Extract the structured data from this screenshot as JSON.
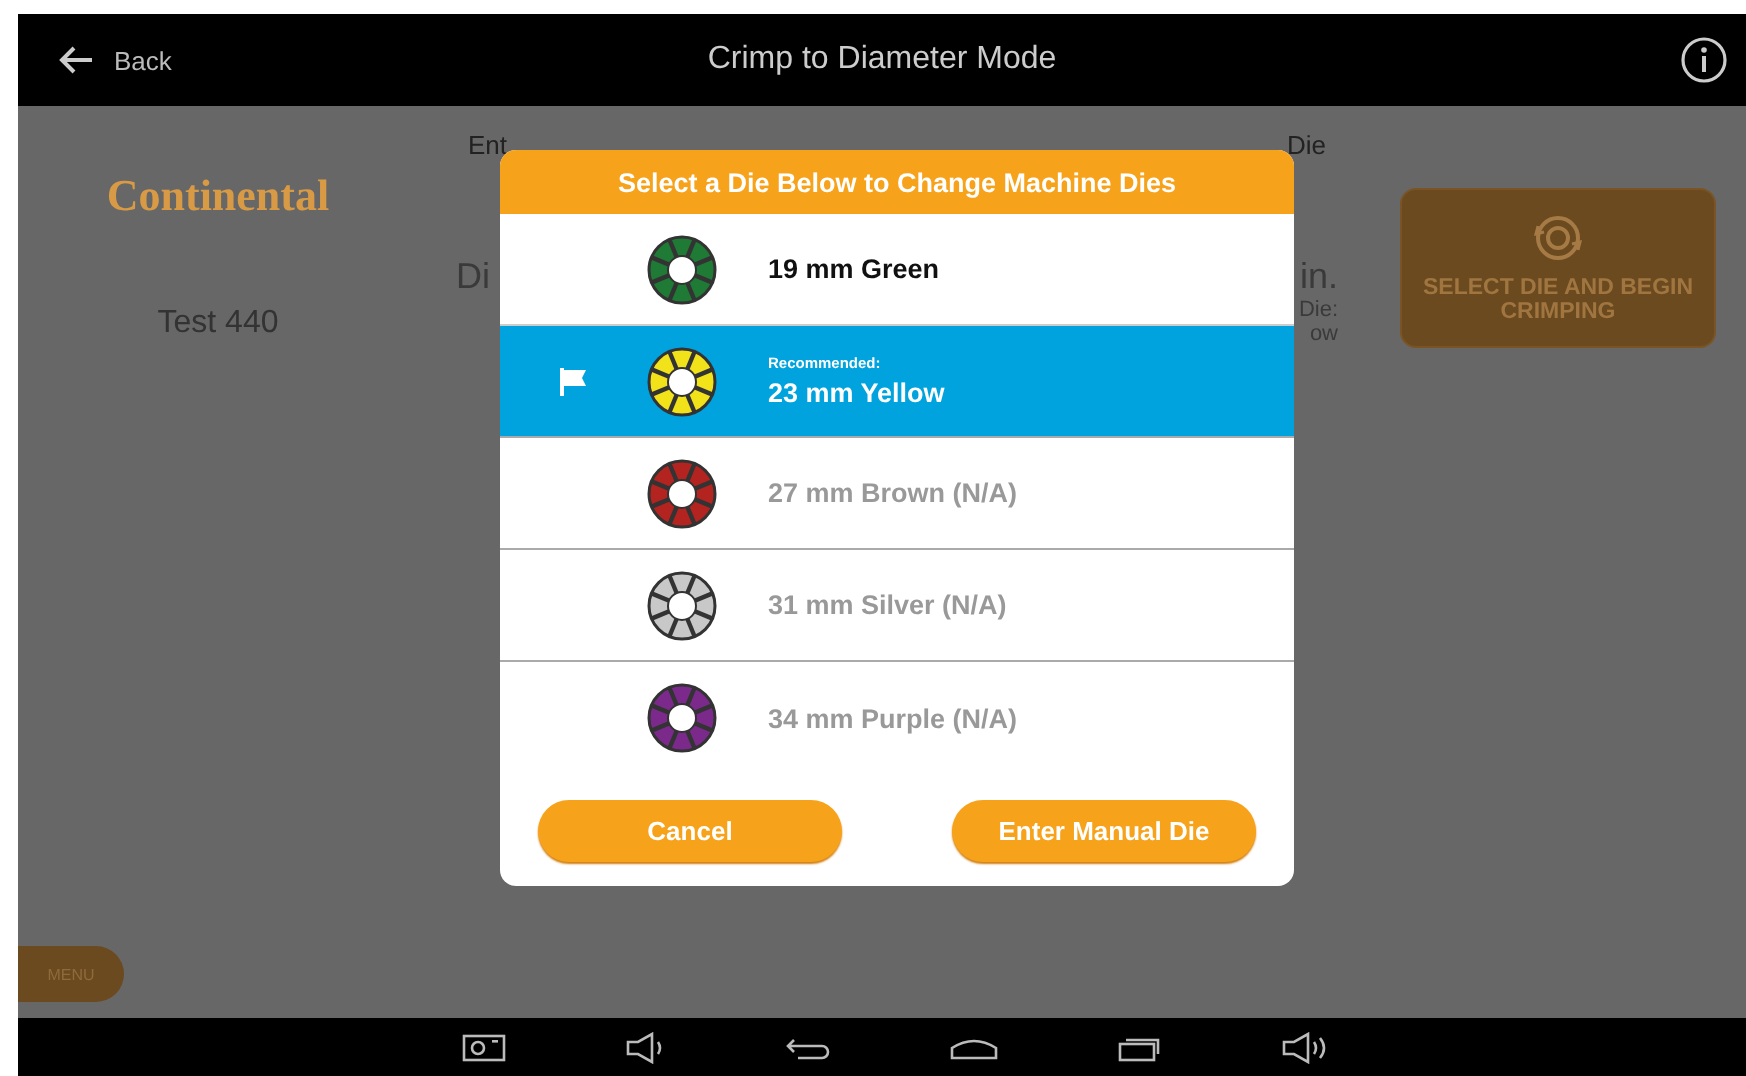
{
  "top_bar": {
    "back": "Back",
    "title": "Crimp to Diameter Mode"
  },
  "background": {
    "logo": "Continental",
    "profile": "Test 440",
    "instruction_start": "Ent",
    "instruction_end": "Die",
    "diameter_left": "Di",
    "diameter_right": "in.",
    "die_label": "Die:",
    "die_value": "ow",
    "begin_button": "SELECT DIE AND BEGIN CRIMPING",
    "menu_button": "MENU"
  },
  "dialog": {
    "title": "Select a Die Below to Change Machine Dies",
    "dies": [
      {
        "label": "19 mm Green",
        "color": "#1e7a34",
        "selected": false,
        "disabled": false
      },
      {
        "label": "23 mm Yellow",
        "note": "Recommended:",
        "color": "#f2e21a",
        "selected": true,
        "disabled": false
      },
      {
        "label": "27 mm Brown (N/A)",
        "color": "#b3231f",
        "selected": false,
        "disabled": true
      },
      {
        "label": "31 mm Silver (N/A)",
        "color": "#c8c8c8",
        "selected": false,
        "disabled": true
      },
      {
        "label": "34 mm Purple (N/A)",
        "color": "#7b2a8c",
        "selected": false,
        "disabled": true
      }
    ],
    "buttons": [
      "Cancel",
      "Enter Manual Die"
    ]
  }
}
